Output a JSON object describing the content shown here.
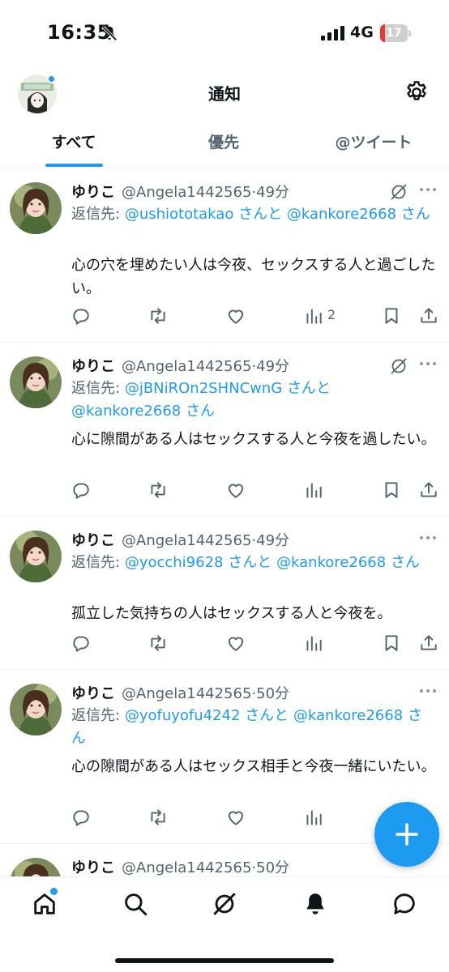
{
  "status_bar": {
    "time": "16:35",
    "network": "4G",
    "battery_level": "17",
    "battery_fraction": 0.17,
    "icons": [
      "bell-slash-icon",
      "signal-bars-icon",
      "battery-icon"
    ]
  },
  "header": {
    "title": "通知",
    "avatar_icon": "profile-avatar",
    "settings_icon": "gear-icon"
  },
  "tabs": [
    {
      "label": "すべて",
      "active": true
    },
    {
      "label": "優先",
      "active": false
    },
    {
      "label": "@ツイート",
      "active": false
    }
  ],
  "tweets": [
    {
      "name": "ゆりこ",
      "handle": "@Angela1442565",
      "dot": "·",
      "time": "49分",
      "reply_prefix": "返信先:",
      "mention1": "@ushiototakao",
      "joiner": "さんと",
      "mention2": "@kankore2668",
      "suffix": "さん",
      "text": "心の穴を埋めたい人は今夜、セックスする人と過ごしたい。",
      "views": "2",
      "has_grok": true
    },
    {
      "name": "ゆりこ",
      "handle": "@Angela1442565",
      "dot": "·",
      "time": "49分",
      "reply_prefix": "返信先:",
      "mention1": "@jBNiROn2SHNCwnG",
      "joiner": "さんと",
      "mention2": "@kankore2668",
      "suffix": "さん",
      "text": "心に隙間がある人はセックスする人と今夜を過したい。",
      "views": "",
      "has_grok": true
    },
    {
      "name": "ゆりこ",
      "handle": "@Angela1442565",
      "dot": "·",
      "time": "49分",
      "reply_prefix": "返信先:",
      "mention1": "@yocchi9628",
      "joiner": "さんと",
      "mention2": "@kankore2668",
      "suffix": "さん",
      "text": "孤立した気持ちの人はセックスする人と今夜を。",
      "views": "",
      "has_grok": false
    },
    {
      "name": "ゆりこ",
      "handle": "@Angela1442565",
      "dot": "·",
      "time": "50分",
      "reply_prefix": "返信先:",
      "mention1": "@yofuyofu4242",
      "joiner": "さんと",
      "mention2": "@kankore2668",
      "suffix": "さん",
      "text": "心の隙間がある人はセックス相手と今夜一緒にいたい。",
      "views": "",
      "has_grok": false
    },
    {
      "name": "ゆりこ",
      "handle": "@Angela1442565",
      "dot": "·",
      "time": "50分"
    }
  ],
  "fab": {
    "icon": "plus-icon"
  },
  "bottom_nav": {
    "items": [
      "home-icon",
      "search-icon",
      "grok-icon",
      "bell-icon",
      "messages-icon"
    ],
    "active": "bell-icon"
  },
  "colors": {
    "accent": "#1d9bf0",
    "text": "#0f1419",
    "secondary": "#536471",
    "border": "#eff3f4",
    "battery_low": "#e23b35"
  }
}
